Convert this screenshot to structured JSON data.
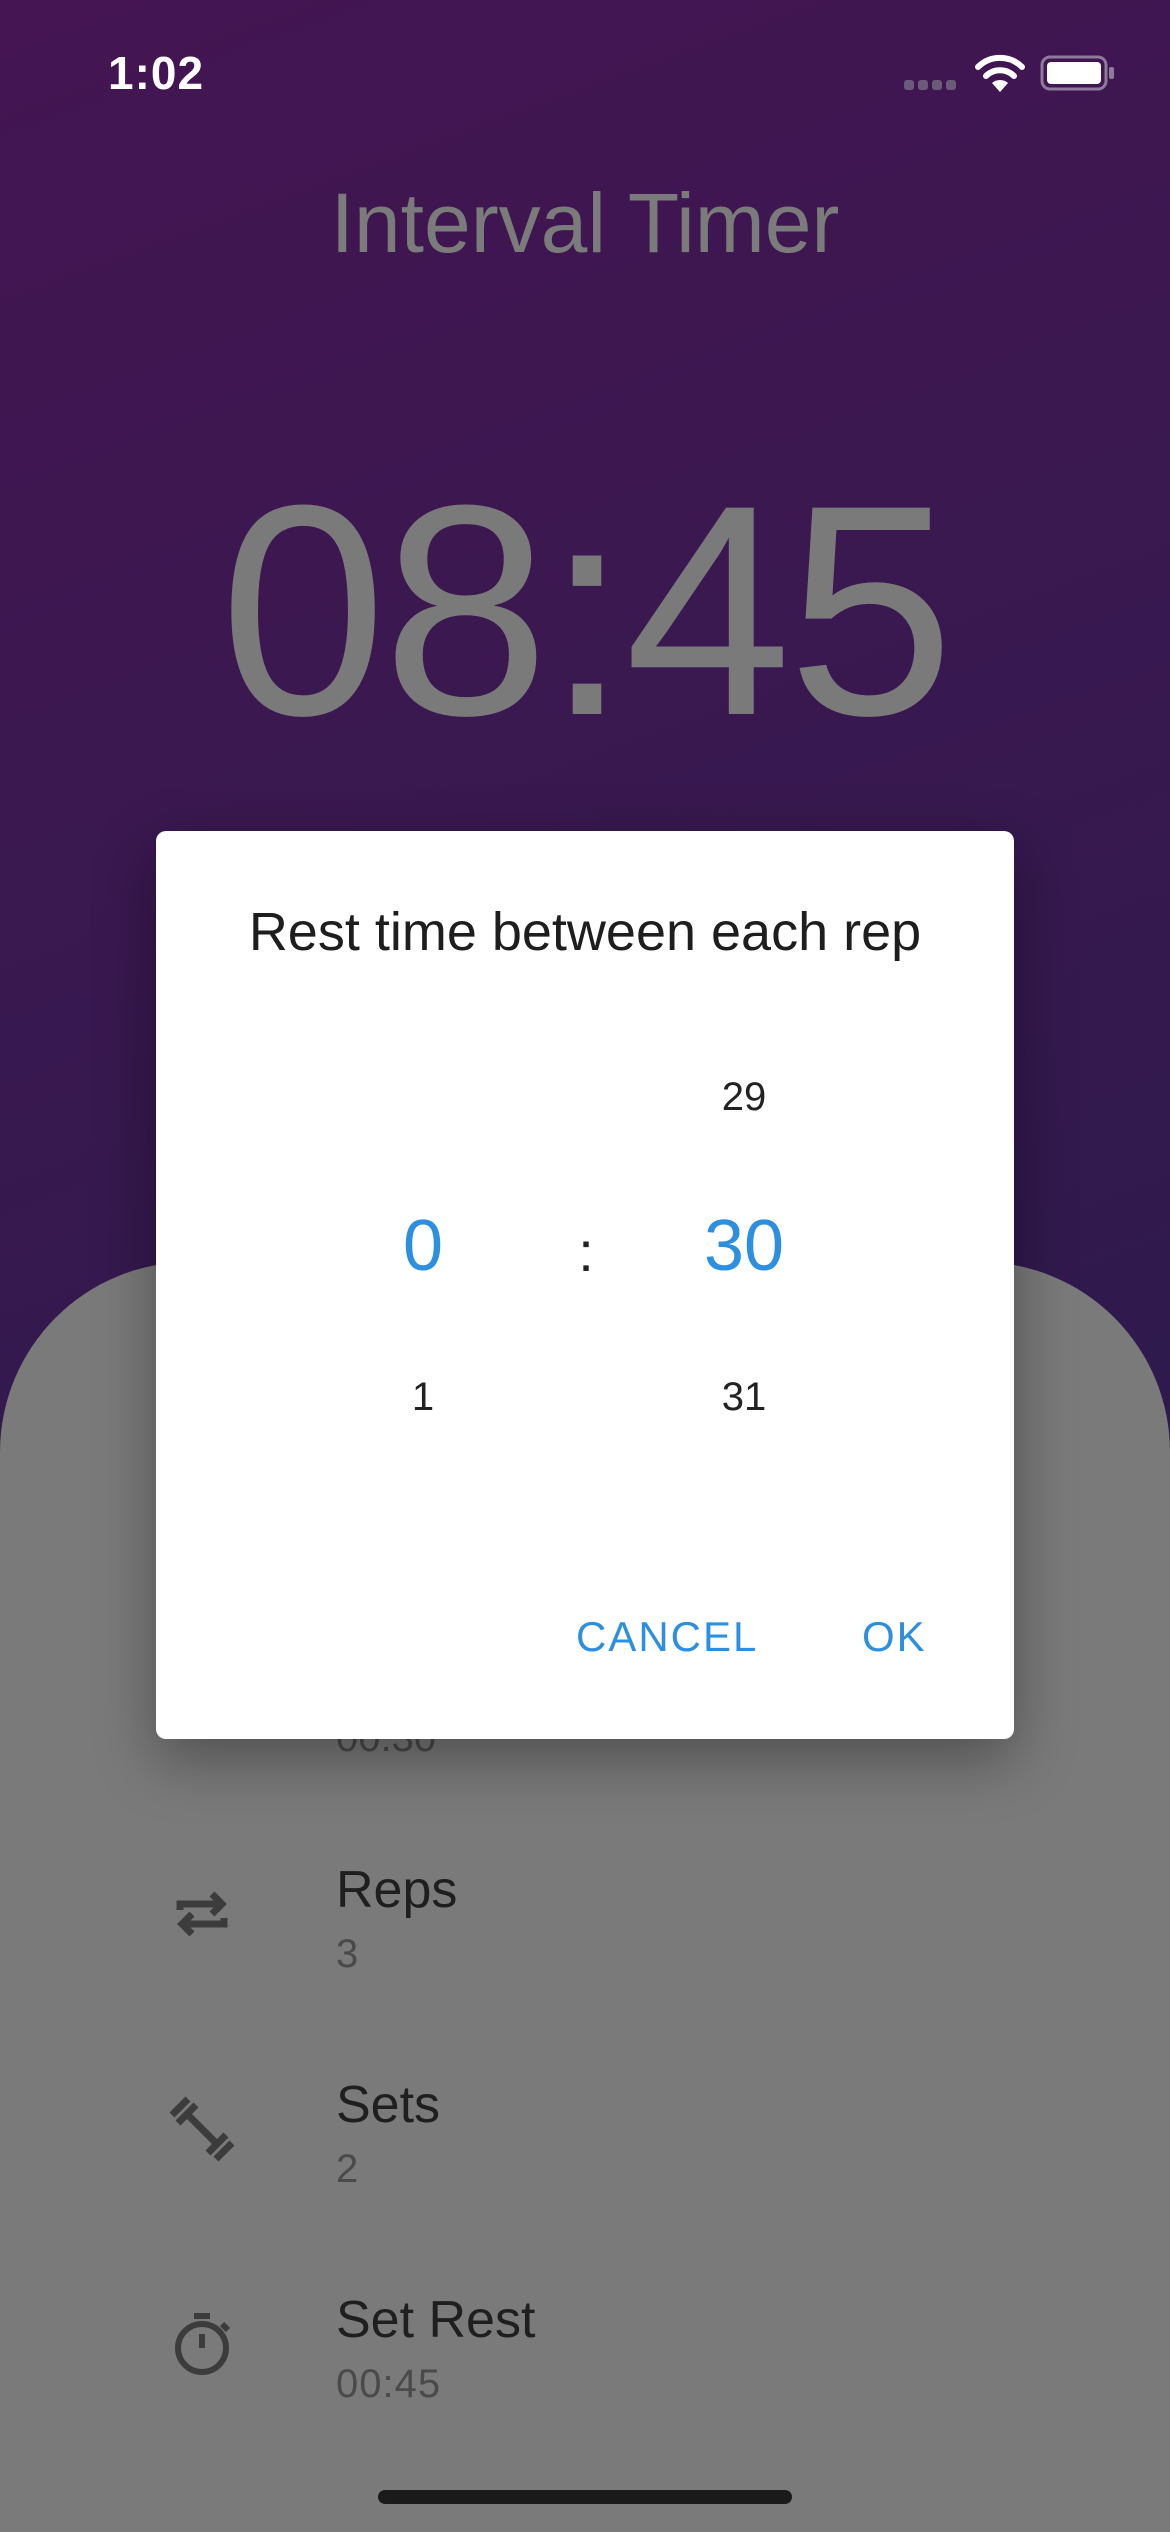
{
  "status_bar": {
    "time": "1:02"
  },
  "header": {
    "title": "Interval Timer",
    "timer": "08:45"
  },
  "settings": {
    "partial_value": "00:30",
    "items": [
      {
        "label": "Reps",
        "value": "3",
        "icon": "repeat-icon"
      },
      {
        "label": "Sets",
        "value": "2",
        "icon": "dumbbell-icon"
      },
      {
        "label": "Set Rest",
        "value": "00:45",
        "icon": "stopwatch-icon"
      }
    ]
  },
  "dialog": {
    "title": "Rest time between each rep",
    "minutes": {
      "previous": "",
      "selected": "0",
      "next": "1"
    },
    "separator": ":",
    "seconds": {
      "previous": "29",
      "selected": "30",
      "next": "31"
    },
    "cancel_label": "CANCEL",
    "ok_label": "OK"
  },
  "colors": {
    "accent": "#2d8fe0",
    "header_gradient_start": "#441552",
    "header_gradient_end": "#2c1a4c",
    "dialog_bg": "#ffffff"
  }
}
